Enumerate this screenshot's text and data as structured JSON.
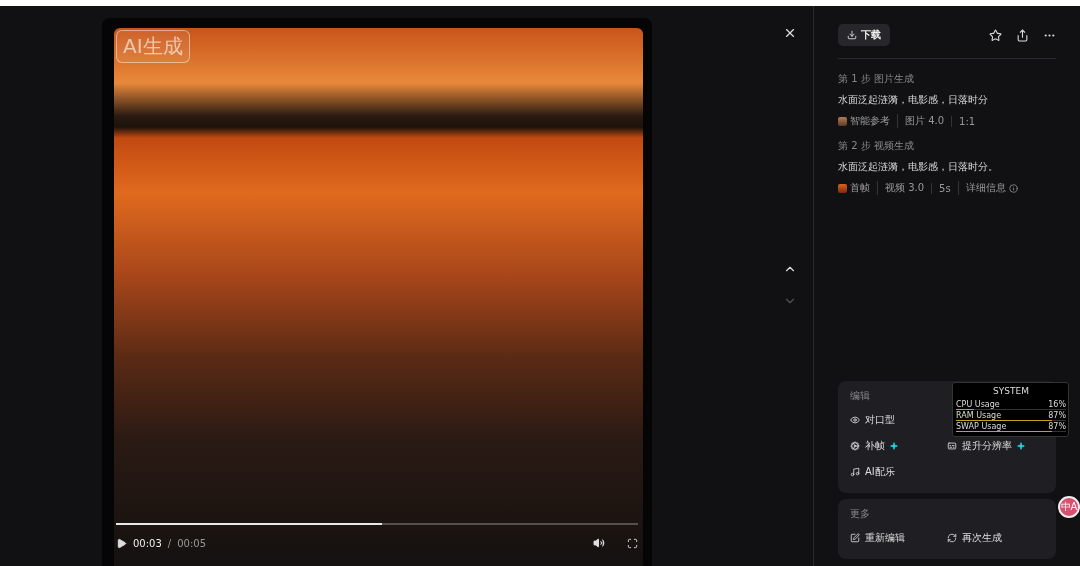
{
  "video": {
    "badge": "AI生成",
    "progress": {
      "level": 0.51
    },
    "current_time": "00:03",
    "time_separator": "/",
    "duration": "00:05"
  },
  "nav": {
    "up_disabled": false,
    "down_disabled": true
  },
  "panel": {
    "download_label": "下载",
    "steps": [
      {
        "title": "第 1 步 图片生成",
        "prompt": "水面泛起涟漪，电影感，日落时分",
        "thumb_label": "智能参考",
        "items": [
          {
            "text": "图片 4.0",
            "kind": "plain"
          },
          {
            "text": "1:1",
            "kind": "plain"
          }
        ]
      },
      {
        "title": "第 2 步 视频生成",
        "prompt": "水面泛起涟漪，电影感，日落时分。",
        "thumb_label": "首帧",
        "items": [
          {
            "text": "视频 3.0",
            "kind": "plain"
          },
          {
            "text": "5s",
            "kind": "plain"
          },
          {
            "text": "详细信息",
            "kind": "info"
          }
        ]
      }
    ],
    "edit": {
      "title": "编辑",
      "rows": [
        [
          {
            "label": "对口型",
            "kind": "lipsync",
            "new": false
          }
        ],
        [
          {
            "label": "补帧",
            "kind": "interpolate",
            "new": true
          },
          {
            "label": "提升分辨率",
            "kind": "upscale",
            "new": true
          }
        ],
        [
          {
            "label": "AI配乐",
            "kind": "music",
            "new": false
          }
        ]
      ]
    },
    "more": {
      "title": "更多",
      "actions": [
        {
          "label": "重新编辑",
          "kind": "reedit"
        },
        {
          "label": "再次生成",
          "kind": "regenerate"
        }
      ]
    }
  },
  "system_monitor": {
    "title": "SYSTEM",
    "rows": [
      {
        "label": "CPU Usage",
        "value": "16%",
        "level": 0.16
      },
      {
        "label": "RAM Usage",
        "value": "87%",
        "level": 0.87
      },
      {
        "label": "SWAP Usage",
        "value": "87%",
        "level": 0.87
      }
    ]
  },
  "translate": {
    "label": "中A"
  }
}
